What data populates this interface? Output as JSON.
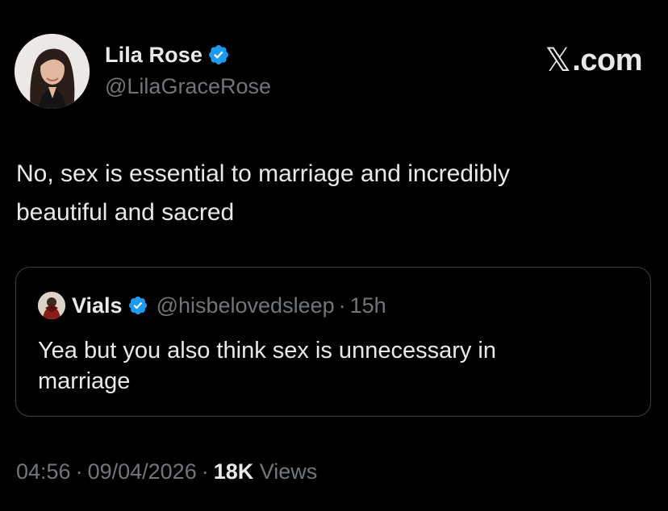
{
  "author": {
    "name": "Lila Rose",
    "handle": "@LilaGraceRose",
    "verified": true
  },
  "brand": {
    "logo_icon": "x-logo-icon",
    "label": ".com"
  },
  "tweet": {
    "text_line1": "No, sex is essential to marriage and incredibly",
    "text_line2": "beautiful and sacred"
  },
  "quoted_tweet": {
    "name": "Vials",
    "handle": "@hisbelovedsleep",
    "separator": "·",
    "time": "15h",
    "verified": true,
    "text_line1": "Yea but you also think sex is unnecessary in",
    "text_line2": "marriage"
  },
  "meta": {
    "time": "04:56",
    "separator": "·",
    "date": "09/04/2026",
    "views_count": "18K",
    "views_label": "Views"
  },
  "colors": {
    "background": "#000000",
    "text_primary": "#e7e9ea",
    "text_secondary": "#71767b",
    "verified_badge": "#1d9bf0",
    "border": "#3a3d41"
  }
}
